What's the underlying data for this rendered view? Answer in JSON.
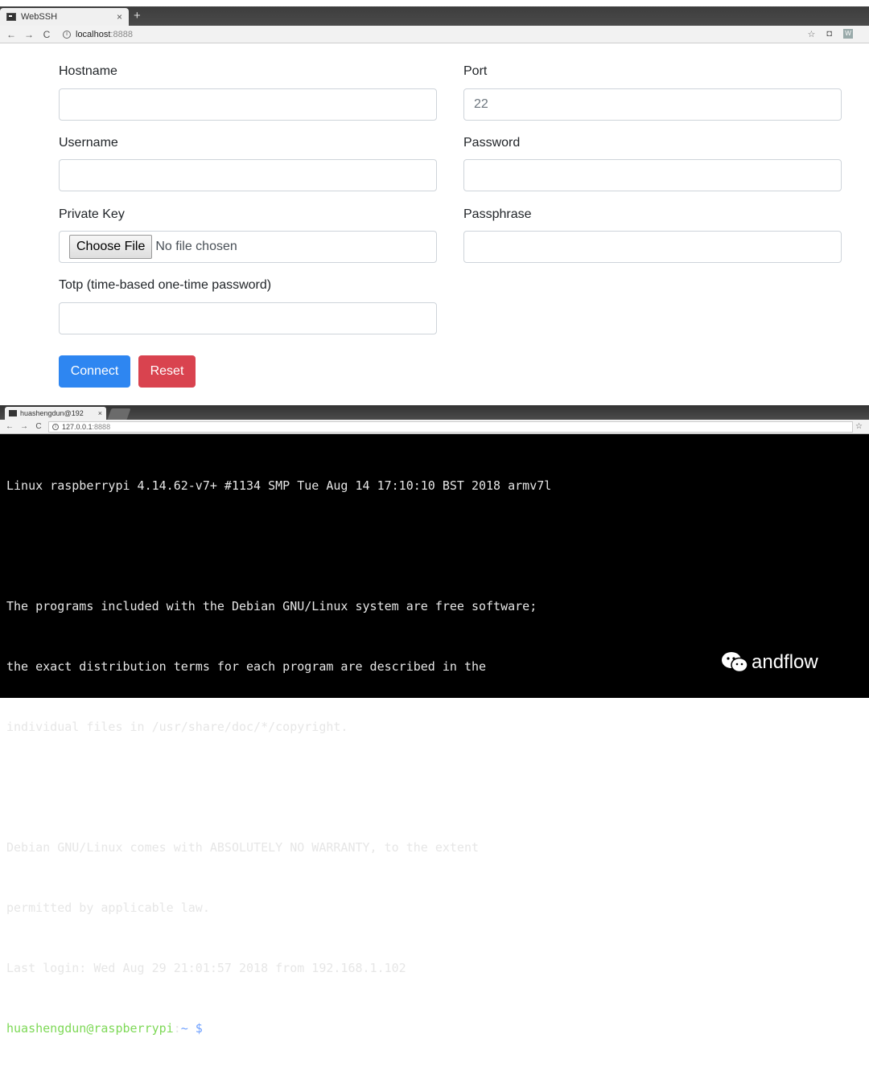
{
  "top_window": {
    "tab_title": "WebSSH",
    "tab_close": "×",
    "new_tab": "+",
    "nav_back": "←",
    "nav_forward": "→",
    "nav_reload": "C",
    "url_info": "i",
    "url_host": "localhost",
    "url_port": ":8888",
    "icon_star": "☆",
    "icon_camera": "◘",
    "icon_ext": "W",
    "form": {
      "hostname_label": "Hostname",
      "hostname_value": "",
      "port_label": "Port",
      "port_value": "22",
      "username_label": "Username",
      "username_value": "",
      "password_label": "Password",
      "password_value": "",
      "privatekey_label": "Private Key",
      "choose_file_label": "Choose File",
      "no_file_text": "No file chosen",
      "passphrase_label": "Passphrase",
      "passphrase_value": "",
      "totp_label": "Totp (time-based one-time password)",
      "totp_value": "",
      "connect_label": "Connect",
      "reset_label": "Reset"
    },
    "colors": {
      "primary": "#2e86f1",
      "danger": "#d9434f"
    }
  },
  "bottom_window": {
    "tab_title": "huashengdun@192",
    "tab_close": "×",
    "nav_back": "←",
    "nav_forward": "→",
    "nav_reload": "C",
    "url_info": "i",
    "url_host": "127.0.0.1",
    "url_port": ":8888",
    "icon_star": "☆",
    "terminal": {
      "lines": [
        "Linux raspberrypi 4.14.62-v7+ #1134 SMP Tue Aug 14 17:10:10 BST 2018 armv7l",
        "",
        "The programs included with the Debian GNU/Linux system are free software;",
        "the exact distribution terms for each program are described in the",
        "individual files in /usr/share/doc/*/copyright.",
        "",
        "Debian GNU/Linux comes with ABSOLUTELY NO WARRANTY, to the extent",
        "permitted by applicable law.",
        "Last login: Wed Aug 29 21:01:57 2018 from 192.168.1.102"
      ],
      "prompt_user": "huashengdun@raspberrypi",
      "prompt_sep": ":",
      "prompt_path": "~ $"
    },
    "watermark_text": "andflow"
  }
}
